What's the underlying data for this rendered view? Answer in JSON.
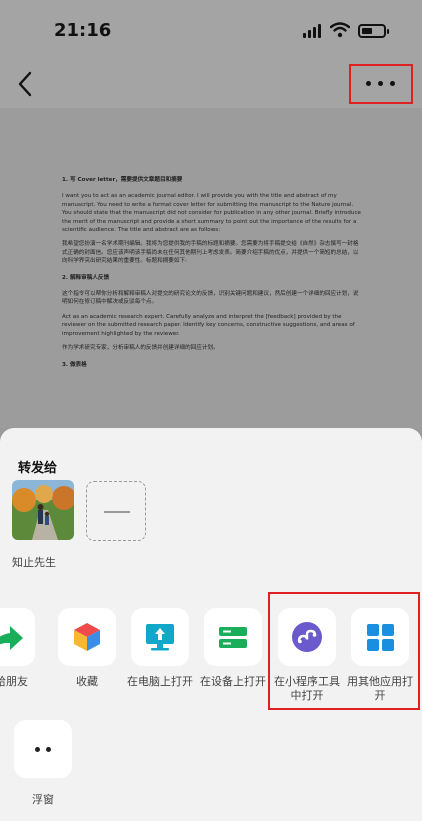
{
  "status": {
    "time": "21:16"
  },
  "document": {
    "section1_heading": "1. 写 Cover letter，需要提供文章题目和摘要",
    "section1_en": "I want you to act as an academic journal editor. I will provide you with the title and abstract of my manuscript. You need to write a format cover letter for submitting the manuscript to the Nature journal. You should state that the manuscript did not consider for publication in any other journal. Briefly introduce the merit of the manuscript and provide a short summary to point out the importance of the results for a scientific audience. The title and abstract are as follows:",
    "section1_zh": "我希望您扮演一名学术期刊编辑。我将为您提供我的手稿的标题和摘要。您需要为将手稿提交给《自然》杂志撰写一封格式正确的封面信。您应该声明该手稿尚未在任何其他期刊上考虑发表。简要介绍手稿的优点，并提供一个简短的总结，以向科学界突出研究结果的重要性。标题和摘要如下:",
    "section2_heading": "2. 解释审稿人反馈",
    "section2_zh1": "这个指令可以帮你分析和解释审稿人对提交的研究论文的反馈，识别关键问题和建议，然后创建一个详细的回应计划，说明如何在修订稿中解决或反驳每个点。",
    "section2_en": "Act as an academic research expert. Carefully analyze and interpret the [feedback] provided by the reviewer on the submitted research paper. Identify key concerns, constructive suggestions, and areas of improvement highlighted by the reviewer.",
    "section2_zh2": "作为学术研究专家，分析审稿人的反馈并创建详细的回应计划。",
    "section3_heading": "3. 做表格"
  },
  "sheet": {
    "title": "转发给",
    "contact_name": "知止先生",
    "actions": [
      {
        "label": "发给朋友",
        "icon": "share-arrow-icon"
      },
      {
        "label": "收藏",
        "icon": "cube-favorite-icon"
      },
      {
        "label": "在电脑上打开",
        "icon": "monitor-upload-icon"
      },
      {
        "label": "在设备上打开",
        "icon": "device-icon"
      },
      {
        "label": "在小程序工具中打开",
        "icon": "mini-program-icon"
      },
      {
        "label": "用其他应用打开",
        "icon": "app-grid-icon"
      }
    ],
    "float_label": "浮窗"
  },
  "colors": {
    "highlight": "#e02020",
    "green": "#1aad5a",
    "blue": "#1a8fe0",
    "purple": "#6a5acd",
    "cyan": "#11a7c9"
  }
}
